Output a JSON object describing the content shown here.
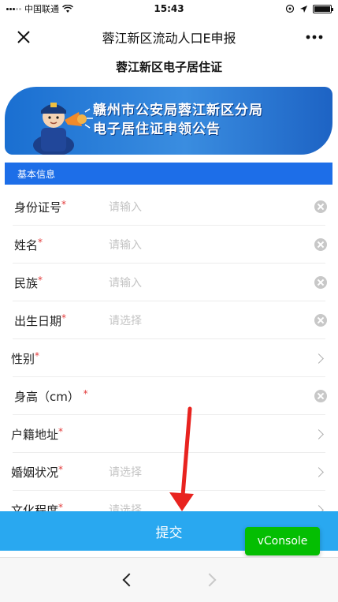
{
  "status_bar": {
    "carrier": "中国联通",
    "time": "15:43",
    "wifi_icon": "wifi-icon",
    "battery_icon": "battery-icon"
  },
  "nav": {
    "title": "蓉江新区流动人口E申报",
    "close_icon": "close-icon",
    "more_icon": "more-icon"
  },
  "page_title": "蓉江新区电子居住证",
  "banner": {
    "line1": "赣州市公安局蓉江新区分局",
    "line2": "电子居住证申领公告"
  },
  "section_header": "基本信息",
  "form_fields": [
    {
      "label": "身份证号",
      "required_mark": "*",
      "placeholder": "请输入",
      "action_icon": "clear-icon"
    },
    {
      "label": "姓名",
      "required_mark": "*",
      "placeholder": "请输入",
      "action_icon": "clear-icon"
    },
    {
      "label": "民族",
      "required_mark": "*",
      "placeholder": "请输入",
      "action_icon": "clear-icon"
    },
    {
      "label": "出生日期",
      "required_mark": "*",
      "placeholder": "请选择",
      "action_icon": "clear-icon"
    },
    {
      "label": "性别",
      "required_mark": "*",
      "placeholder": "",
      "action_icon": "chevron-right-icon"
    },
    {
      "label": "身高（cm）",
      "required_mark": "*",
      "placeholder": "",
      "action_icon": "clear-icon"
    },
    {
      "label": "户籍地址",
      "required_mark": "*",
      "placeholder": "",
      "action_icon": "chevron-right-icon"
    },
    {
      "label": "婚姻状况",
      "required_mark": "*",
      "placeholder": "请选择",
      "action_icon": "chevron-right-icon"
    },
    {
      "label": "文化程度",
      "required_mark": "*",
      "placeholder": "请选择",
      "action_icon": "chevron-right-icon"
    }
  ],
  "submit_label": "提交",
  "vconsole_label": "vConsole",
  "bottom_bar": {
    "back_icon": "back-icon",
    "forward_icon": "forward-icon"
  },
  "colors": {
    "primary": "#1d6ee8",
    "submit": "#29a8f0",
    "vconsole": "#04be02",
    "required": "#e23b3b",
    "annotation_arrow": "#e8231f"
  }
}
